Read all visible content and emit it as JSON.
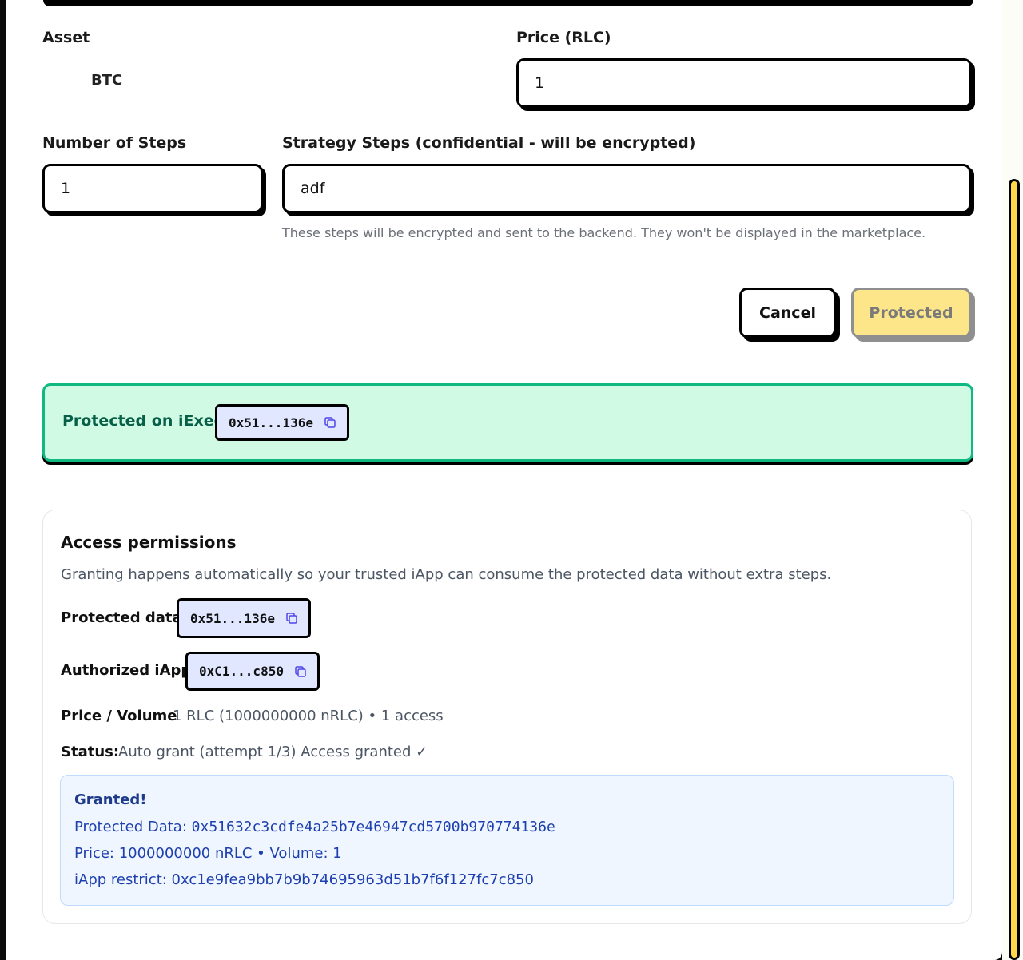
{
  "form": {
    "asset_label": "Asset",
    "asset_value": "BTC",
    "price_label": "Price (RLC)",
    "price_value": "1",
    "steps_count_label": "Number of Steps",
    "steps_count_value": "1",
    "strategy_label": "Strategy Steps (confidential - will be encrypted)",
    "strategy_value": "adf",
    "strategy_helper": "These steps will be encrypted and sent to the backend. They won't be displayed in the marketplace."
  },
  "actions": {
    "cancel_label": "Cancel",
    "protected_label": "Protected"
  },
  "protected_notice": {
    "label": "Protected on iExec:",
    "address_short": "0x51...136e"
  },
  "permissions": {
    "title": "Access permissions",
    "description": "Granting happens automatically so your trusted iApp can consume the protected data without extra steps.",
    "protected_data_label": "Protected data",
    "protected_data_short": "0x51...136e",
    "authorized_iapp_label": "Authorized iApp",
    "authorized_iapp_short": "0xC1...c850",
    "price_volume_label": "Price / Volume",
    "price_volume_value": "1 RLC (1000000000 nRLC) • 1 access",
    "status_label": "Status:",
    "status_value": "Auto grant (attempt 1/3) Access granted ✓",
    "granted": {
      "title": "Granted!",
      "protected_data_prefix": "Protected Data:",
      "protected_data_full": "0x51632c3cdfe4a25b7e46947cd5700b970774136e",
      "price_volume": "Price: 1000000000 nRLC • Volume: 1",
      "iapp_restrict": "iApp restrict: 0xc1e9fea9bb7b9b74695963d51b7f6f127fc7c850"
    }
  },
  "colors": {
    "accent_yellow": "#fde68a",
    "success_green": "#10b981",
    "chip_bg": "#e0e7ff",
    "info_blue": "#1e40af"
  }
}
